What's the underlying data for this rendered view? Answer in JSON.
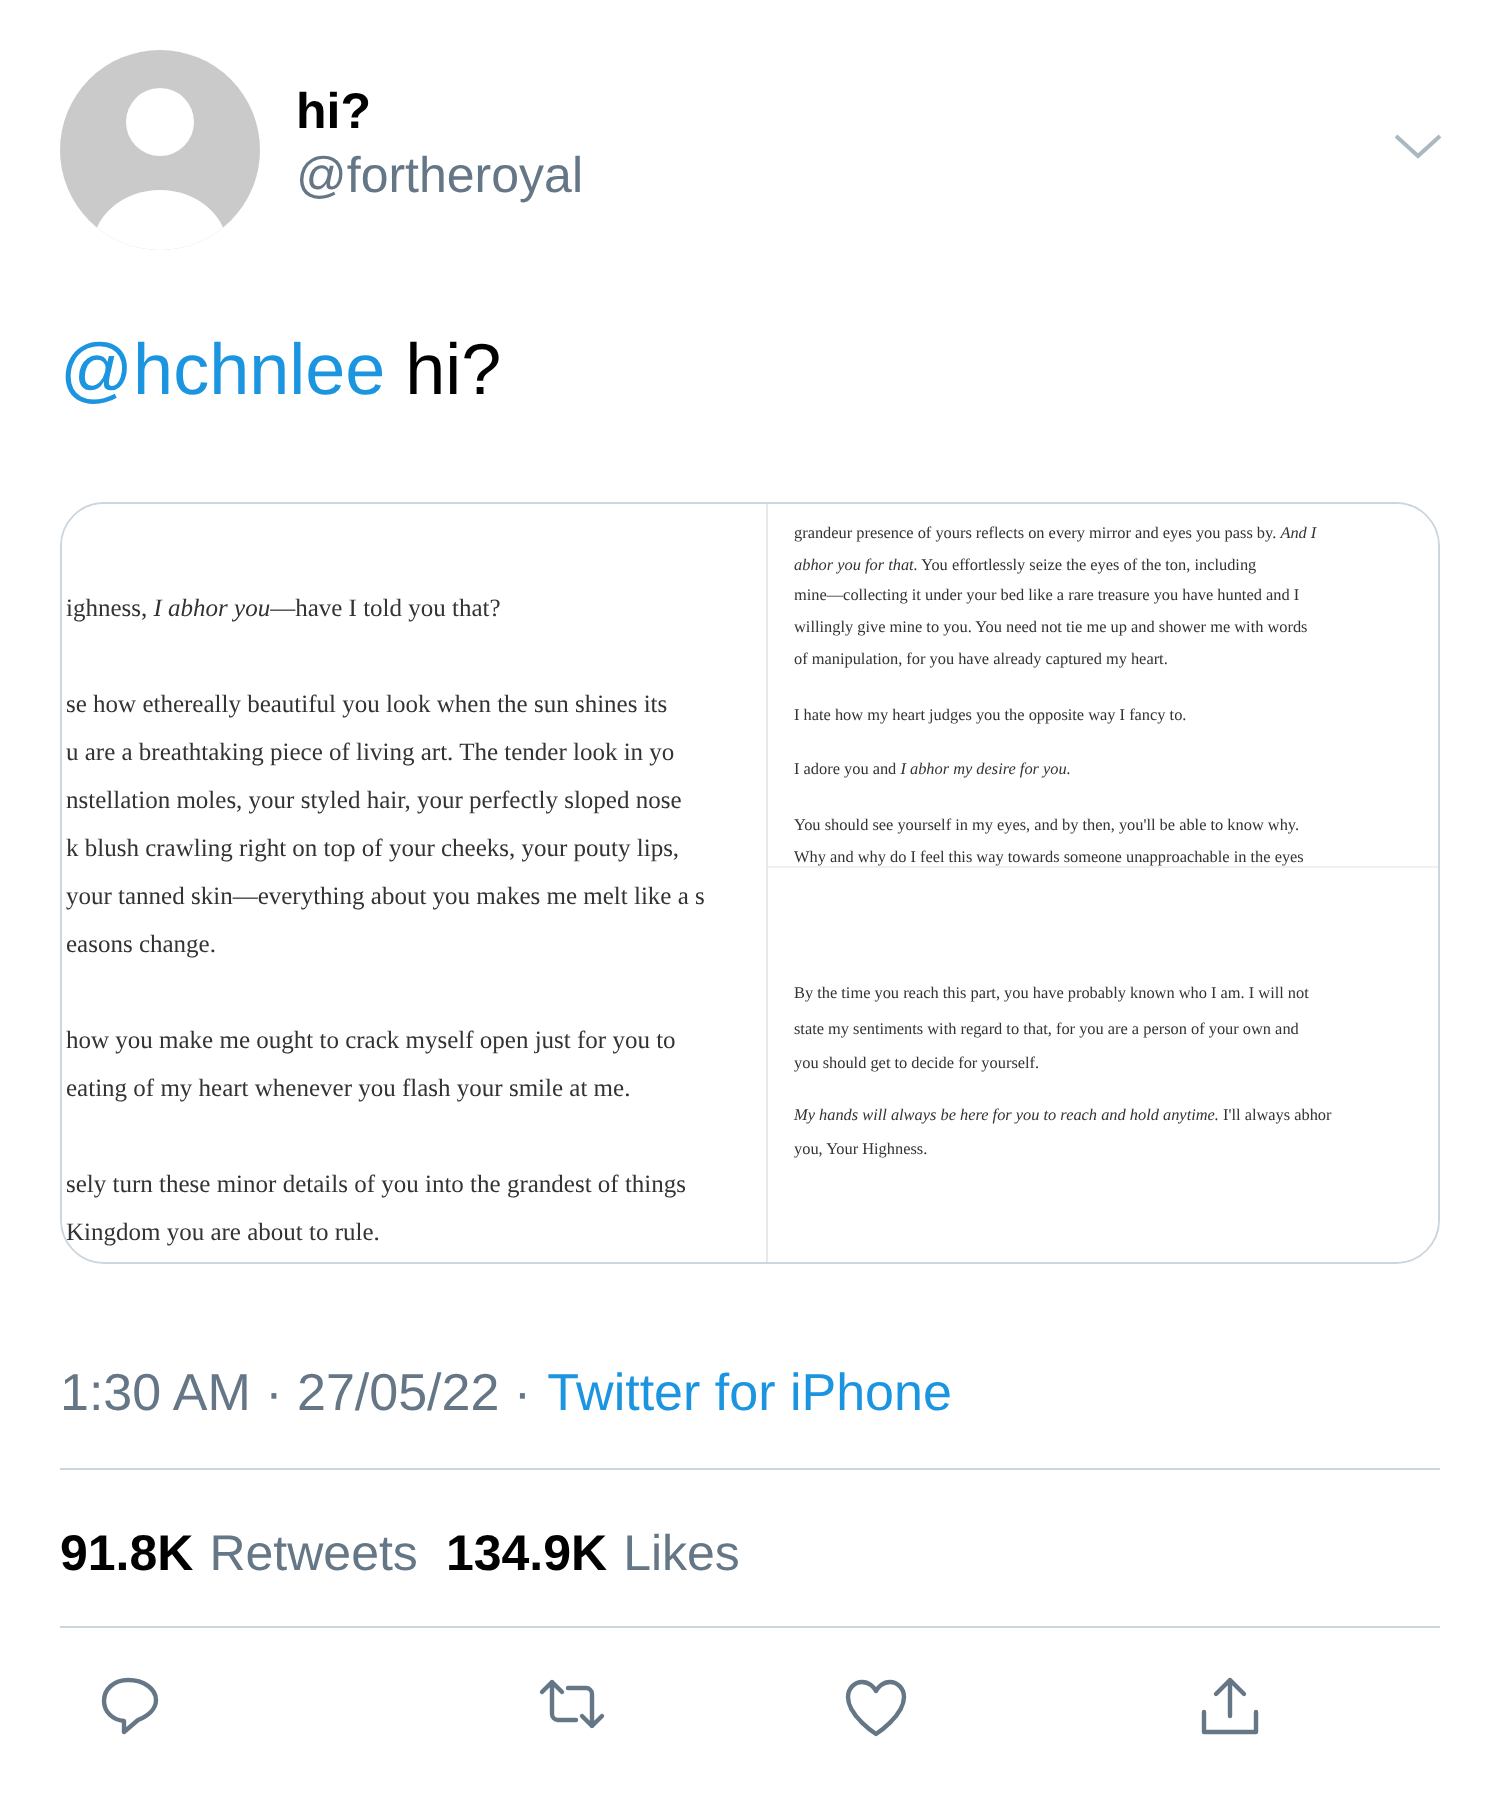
{
  "author": {
    "name": "hi?",
    "handle": "@fortheroyal"
  },
  "tweet": {
    "mention": "@hchnlee",
    "text": "hi?"
  },
  "media": {
    "images": [
      {
        "panels": [
          {
            "paragraphs": [
              [
                "ighness, *I abhor you*—have I told you that?"
              ],
              [
                "se how ethereally beautiful you look when the sun shines its",
                "u are a breathtaking piece of living art. The tender look in yo",
                "nstellation moles, your styled hair, your perfectly sloped nose",
                "k blush crawling right on top of your cheeks, your pouty lips,",
                "your tanned skin—everything about you makes me melt like a s",
                "easons change."
              ],
              [
                "how you make me ought to crack myself open just for you to",
                "eating of my heart whenever you flash your smile at me."
              ],
              [
                "sely turn these minor details of you into the grandest of things",
                "Kingdom you are about to rule."
              ]
            ]
          }
        ]
      },
      {
        "panels": [
          {
            "paragraphs": [
              [
                "grandeur presence of yours reflects on every mirror and eyes you pass by. *And I*",
                "*abhor you for that.* You effortlessly seize the eyes of the ton, including",
                "mine—collecting it under your bed like a rare treasure you have hunted and I",
                "willingly give mine to you. You need not tie me up and shower me with words",
                "of manipulation, for you have already captured my heart."
              ],
              [
                "I hate how my heart judges you the opposite way I fancy to."
              ],
              [
                "I adore you and *I abhor my desire for you.*"
              ],
              [
                "You should see yourself in my eyes, and by then, you'll be able to know why.",
                "Why and why do I feel this way towards someone unapproachable in the eyes"
              ]
            ]
          },
          {
            "paragraphs": [
              [
                "By the time you reach this part, you have probably known who I am. I will not",
                "state my sentiments with regard to that, for you are a person of your own and",
                "you should get to decide for yourself."
              ],
              [
                "*My hands will always be here for you to reach and hold anytime.* I'll always abhor",
                "you, Your Highness."
              ]
            ]
          }
        ]
      }
    ]
  },
  "meta": {
    "time": "1:30 AM · 27/05/22 ·",
    "source": "Twitter for iPhone"
  },
  "stats": [
    {
      "count": "91.8K",
      "label": "Retweets"
    },
    {
      "count": "134.9K",
      "label": "Likes"
    }
  ],
  "actions": [
    {
      "kind": "reply"
    },
    {
      "kind": "retweet"
    },
    {
      "kind": "like"
    },
    {
      "kind": "share"
    }
  ]
}
